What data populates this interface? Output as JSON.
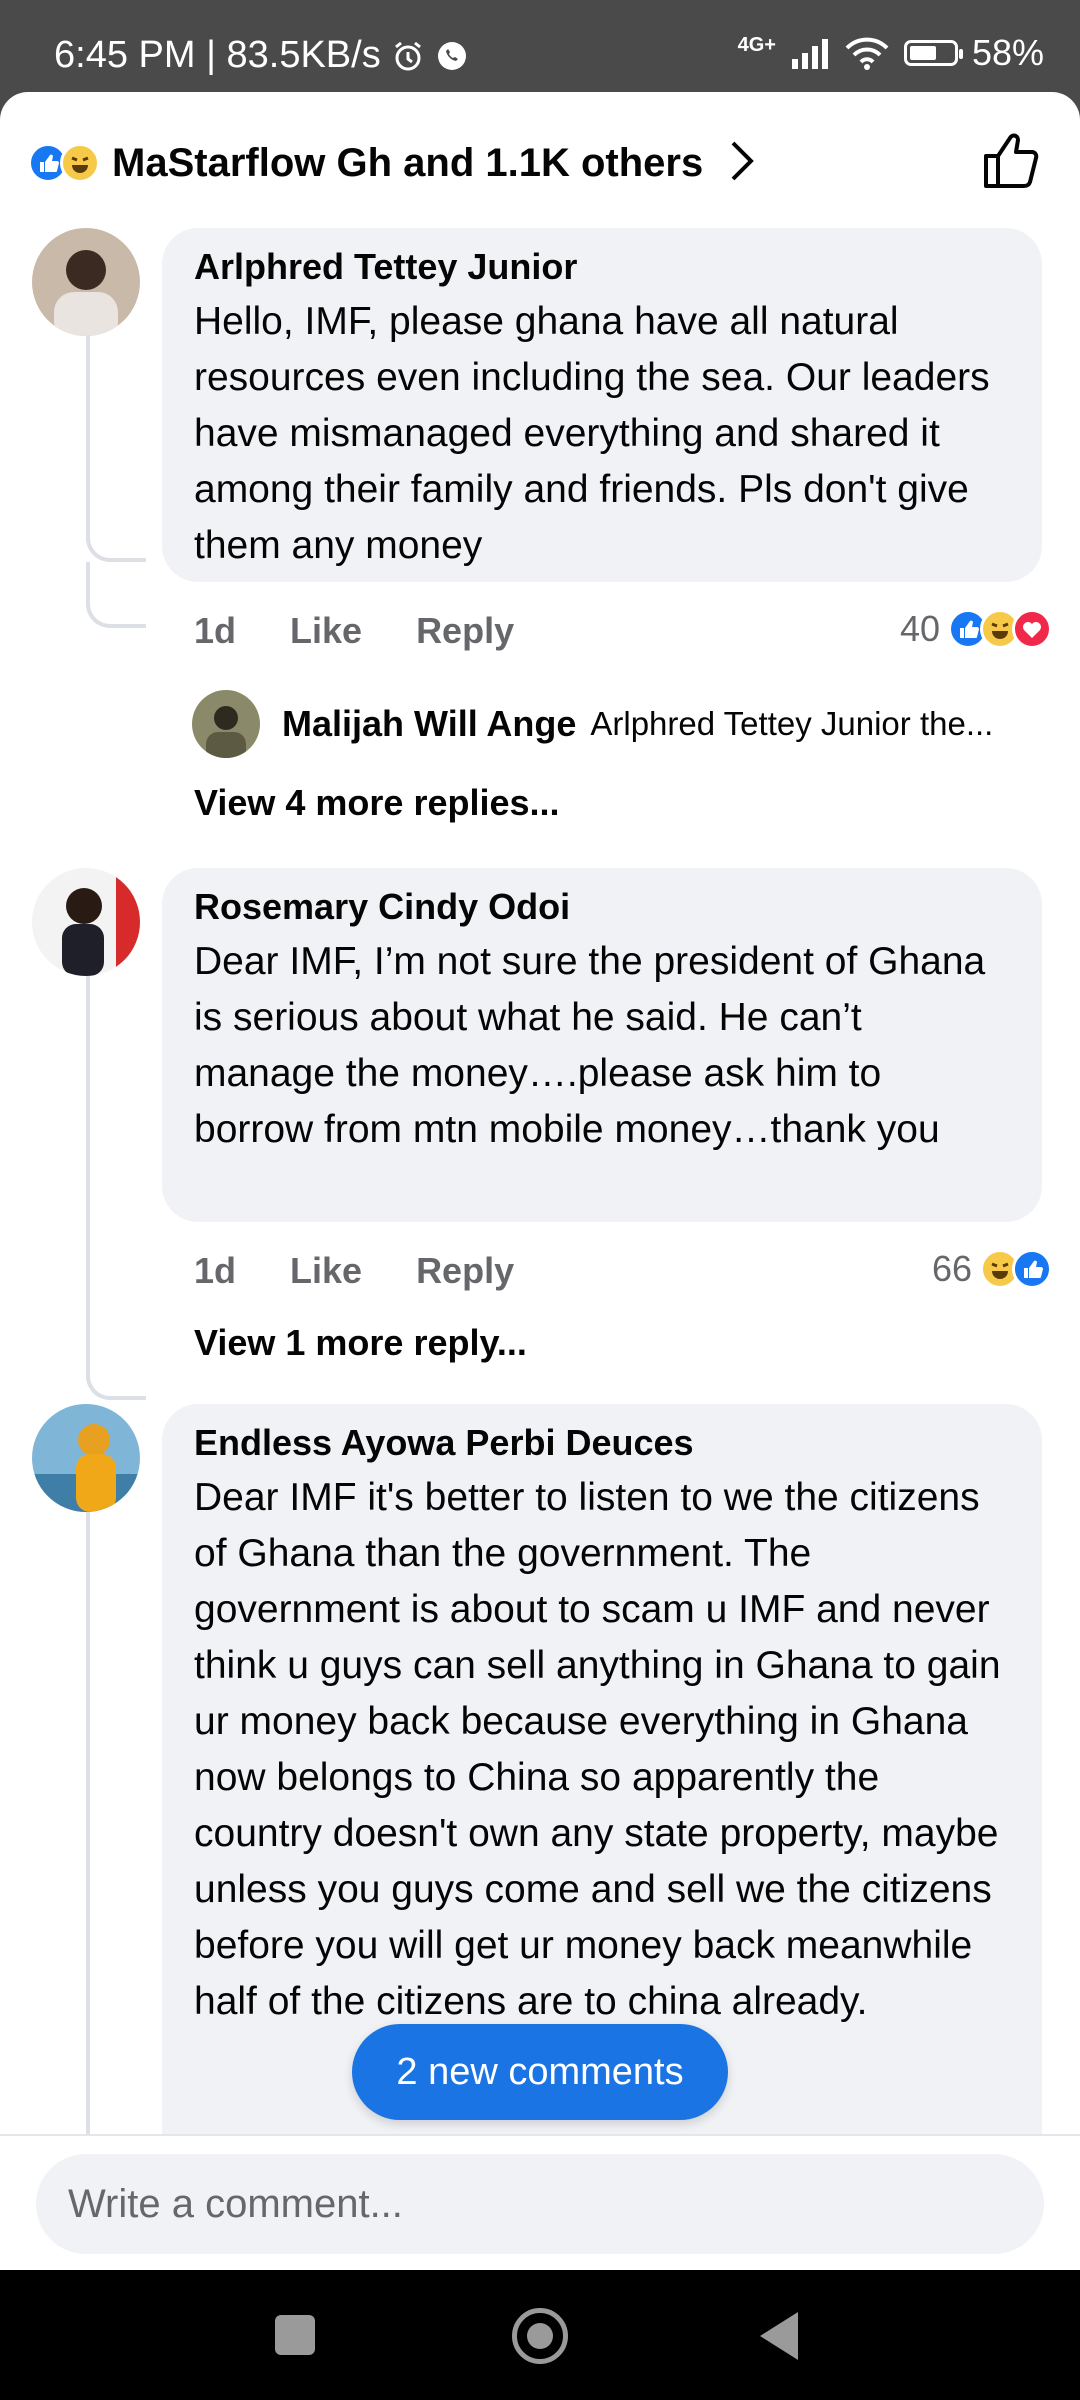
{
  "status_bar": {
    "time_speed": "6:45 PM | 83.5KB/s",
    "network": "4G+",
    "battery": "58%",
    "battery_level": 0.58
  },
  "header": {
    "reactions_text": "MaStarflow Gh and 1.1K others"
  },
  "comments": [
    {
      "author": "Arlphred Tettey Junior",
      "text": "Hello, IMF, please ghana  have all natural resources even including the sea. Our leaders have mismanaged everything and shared it among their family and friends. Pls don't give them any money",
      "time": "1d",
      "like": "Like",
      "reply": "Reply",
      "reaction_count": "40",
      "reply_preview": {
        "author": "Malijah  Will Ange",
        "text": "Arlphred Tettey Junior the..."
      },
      "view_more": "View 4 more replies..."
    },
    {
      "author": "Rosemary Cindy Odoi",
      "text": "Dear IMF, I’m not sure the president of Ghana is serious about what he said. He can’t manage the money….please ask him to borrow from mtn mobile money…thank you",
      "time": "1d",
      "like": "Like",
      "reply": "Reply",
      "reaction_count": "66",
      "view_more": "View 1 more reply..."
    },
    {
      "author": "Endless Ayowa Perbi Deuces",
      "text": "Dear IMF it's better to listen to we the citizens of Ghana than the government. The government is about to scam u IMF and never think u guys can sell anything in Ghana to gain ur money back because everything in Ghana now belongs to China so apparently the country doesn't own any state property, maybe unless you guys come and sell we the citizens before you will get ur money back meanwhile half of the citizens are to china already."
    }
  ],
  "new_comments_pill": "2 new comments",
  "composer": {
    "placeholder": "Write a comment..."
  }
}
